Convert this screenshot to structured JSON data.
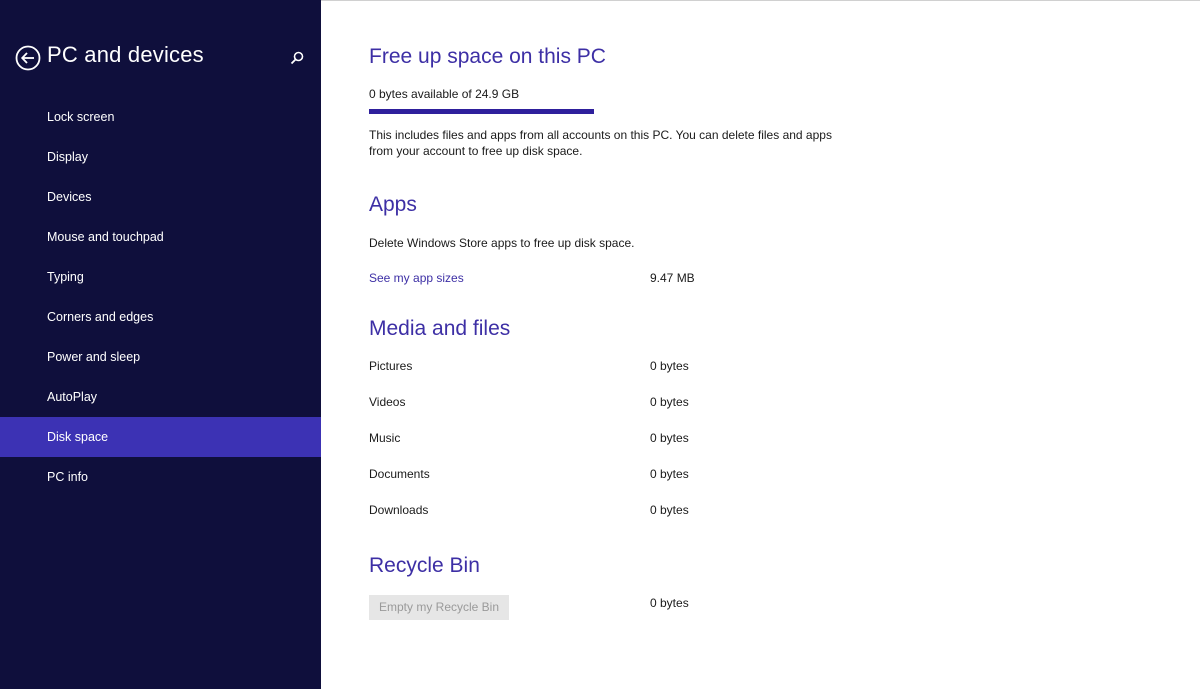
{
  "sidebar": {
    "title": "PC and devices",
    "items": [
      {
        "label": "Lock screen"
      },
      {
        "label": "Display"
      },
      {
        "label": "Devices"
      },
      {
        "label": "Mouse and touchpad"
      },
      {
        "label": "Typing"
      },
      {
        "label": "Corners and edges"
      },
      {
        "label": "Power and sleep"
      },
      {
        "label": "AutoPlay"
      },
      {
        "label": "Disk space",
        "selected": true
      },
      {
        "label": "PC info"
      }
    ],
    "icons": {
      "back": "back-arrow-icon",
      "search": "search-icon"
    }
  },
  "free_space": {
    "heading": "Free up space on this PC",
    "available_text": "0 bytes available of 24.9 GB",
    "used_fraction": 1.0,
    "description": "This includes files and apps from all accounts on this PC. You can delete files and apps from your account to free up disk space."
  },
  "apps": {
    "heading": "Apps",
    "description": "Delete Windows Store apps to free up disk space.",
    "link_label": "See my app sizes",
    "size": "9.47 MB"
  },
  "media": {
    "heading": "Media and files",
    "rows": [
      {
        "label": "Pictures",
        "value": "0 bytes"
      },
      {
        "label": "Videos",
        "value": "0 bytes"
      },
      {
        "label": "Music",
        "value": "0 bytes"
      },
      {
        "label": "Documents",
        "value": "0 bytes"
      },
      {
        "label": "Downloads",
        "value": "0 bytes"
      }
    ]
  },
  "recycle": {
    "heading": "Recycle Bin",
    "button_label": "Empty my Recycle Bin",
    "size": "0 bytes",
    "button_enabled": false
  },
  "colors": {
    "sidebar_bg": "#0f0f3c",
    "selected_bg": "#3c32b4",
    "accent": "#3d2fa5",
    "progress_fill": "#2e1f9c"
  }
}
